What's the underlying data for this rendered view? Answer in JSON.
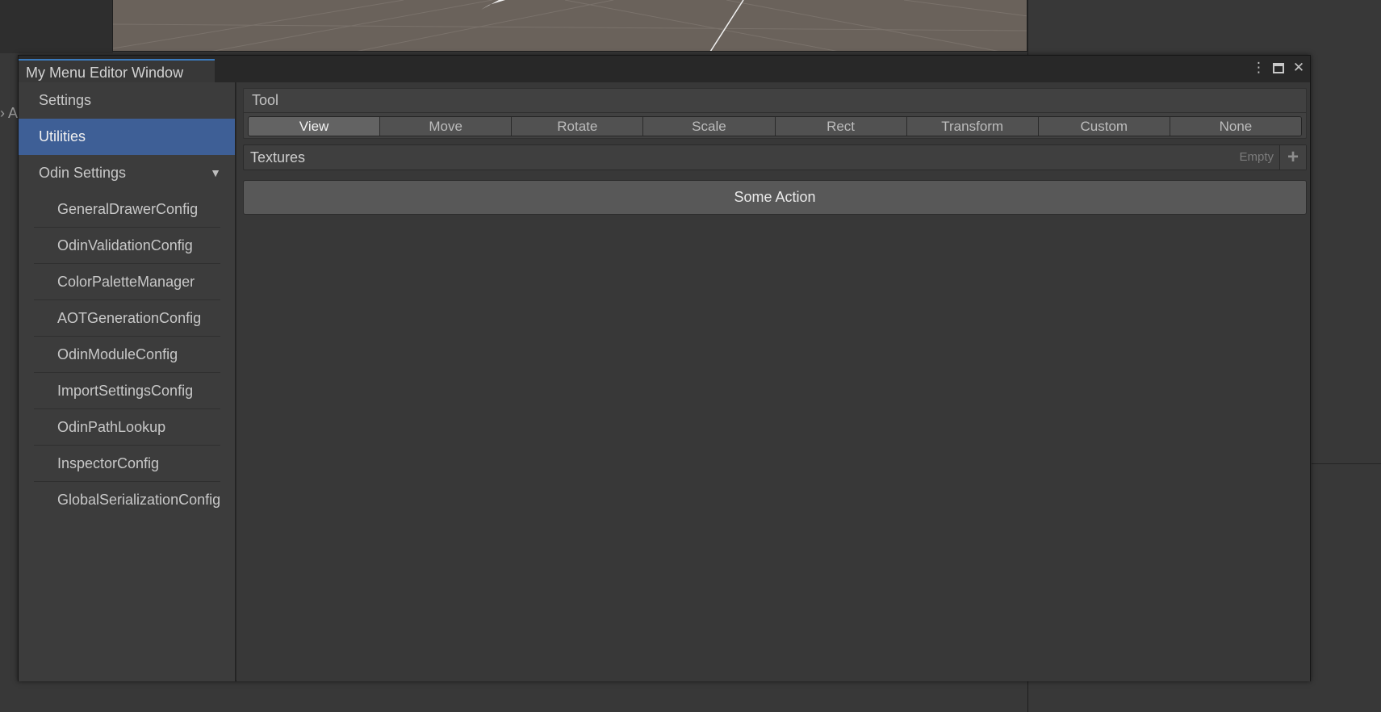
{
  "window": {
    "title": "My Menu Editor Window",
    "controls": {
      "more": "⋮",
      "close": "✕"
    }
  },
  "sidebar": {
    "items": [
      {
        "label": "Settings",
        "selected": false
      },
      {
        "label": "Utilities",
        "selected": true
      },
      {
        "label": "Odin Settings",
        "expanded": true,
        "chevron": "▼"
      }
    ],
    "odin_settings_children": [
      "GeneralDrawerConfig",
      "OdinValidationConfig",
      "ColorPaletteManager",
      "AOTGenerationConfig",
      "OdinModuleConfig",
      "ImportSettingsConfig",
      "OdinPathLookup",
      "InspectorConfig",
      "GlobalSerializationConfig"
    ]
  },
  "content": {
    "tool": {
      "title": "Tool",
      "buttons": [
        "View",
        "Move",
        "Rotate",
        "Scale",
        "Rect",
        "Transform",
        "Custom",
        "None"
      ],
      "selected": "View"
    },
    "textures": {
      "label": "Textures",
      "empty_text": "Empty",
      "add_icon": "+"
    },
    "action_button": "Some Action"
  },
  "background": {
    "partial_label": "A"
  },
  "colors": {
    "selection": "#3e5f96",
    "tab_accent": "#3a79bb",
    "panel_bg": "#383838",
    "sidebar_bg": "#3c3c3c",
    "scene_bg": "#6a625b"
  }
}
